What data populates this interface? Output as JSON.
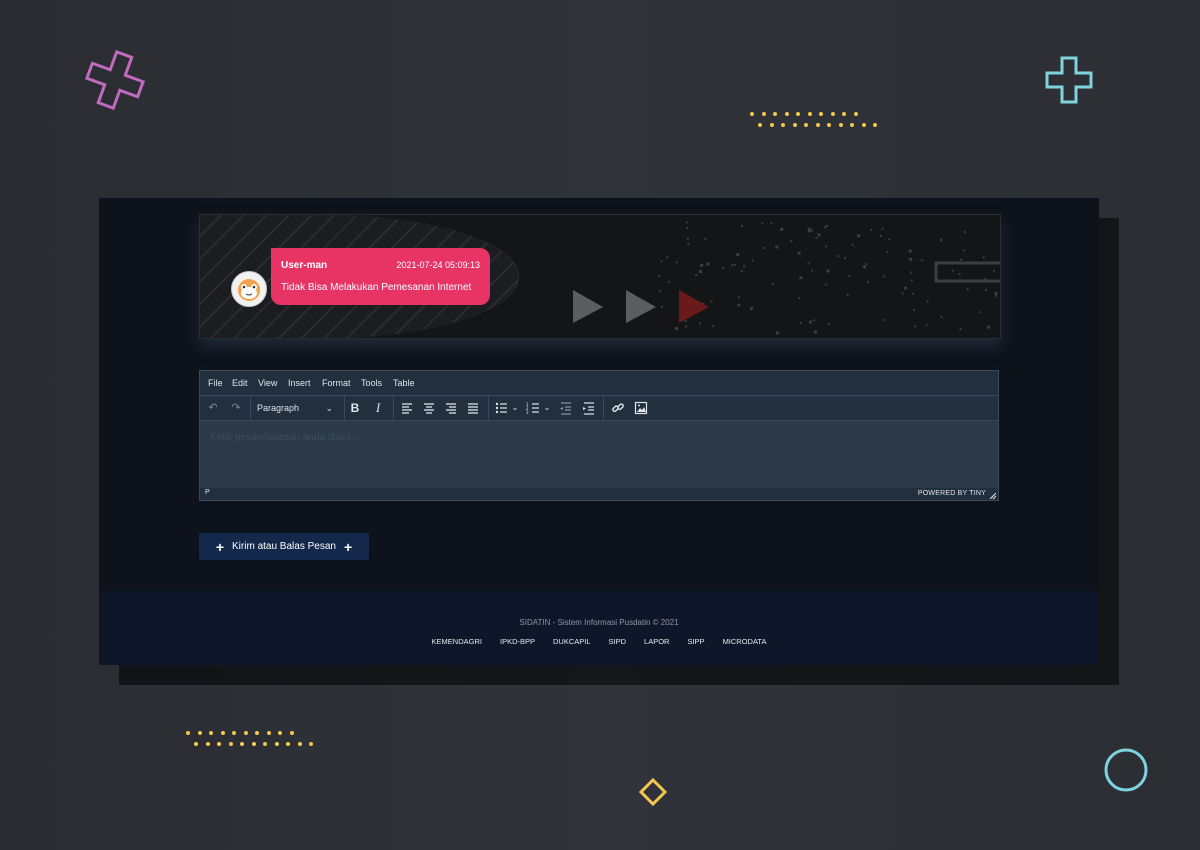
{
  "chat": {
    "username": "User-man",
    "timestamp": "2021-07-24 05:09:13",
    "message": "Tidak Bisa Melakukan Pemesanan Internet"
  },
  "editor": {
    "menu": [
      "File",
      "Edit",
      "View",
      "Insert",
      "Format",
      "Tools",
      "Table"
    ],
    "block_format": "Paragraph",
    "placeholder": "Ketik pesan/balasan anda disini...",
    "status_path": "P",
    "branding": "POWERED BY TINY"
  },
  "send_button": {
    "label": "Kirim atau Balas Pesan"
  },
  "footer": {
    "copyright": "SIDATIN - Sistem Informasi Pusdatin © 2021",
    "links": [
      "KEMENDAGRI",
      "IPKD-BPP",
      "DUKCAPIL",
      "SIPD",
      "LAPOR",
      "SIPP",
      "MICRODATA"
    ]
  },
  "colors": {
    "page_bg": "#2b2d33",
    "bubble": "#e83465",
    "button": "#14284b",
    "editor": "#222f3e",
    "accent_yellow": "#f2c94c",
    "accent_pink": "#c06ac0",
    "accent_cyan": "#7fd3de"
  }
}
